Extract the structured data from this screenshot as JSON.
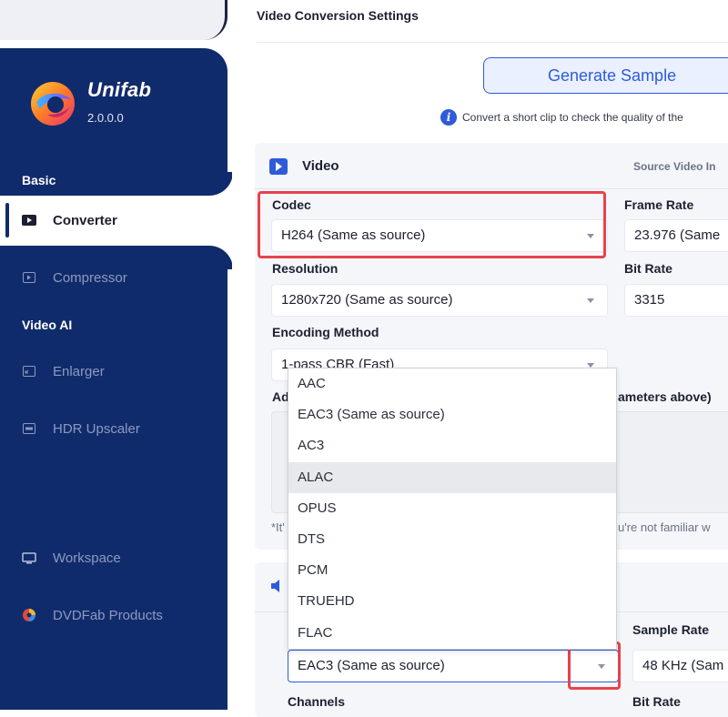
{
  "sidebar": {
    "brand": "Unifab",
    "version": "2.0.0.0",
    "sections": {
      "basic": "Basic",
      "video_ai": "Video AI"
    },
    "items": {
      "converter": "Converter",
      "compressor": "Compressor",
      "enlarger": "Enlarger",
      "hdr_upscaler": "HDR Upscaler",
      "workspace": "Workspace",
      "dvdfab_products": "DVDFab Products"
    },
    "active_item": "converter"
  },
  "main": {
    "title": "Video Conversion Settings",
    "generate_sample_label": "Generate Sample",
    "info_text": "Convert a short clip to check the quality of the"
  },
  "video": {
    "section_label": "Video",
    "source_info": "Source Video In",
    "codec": {
      "label": "Codec",
      "value": "H264 (Same as source)"
    },
    "frame_rate": {
      "label": "Frame Rate",
      "value": "23.976 (Same"
    },
    "resolution": {
      "label": "Resolution",
      "value": "1280x720 (Same as source)"
    },
    "bit_rate": {
      "label": "Bit Rate",
      "value": "3315"
    },
    "encoding_method": {
      "label": "Encoding Method",
      "value": "1-pass CBR (Fast)"
    },
    "advanced_label_start": "Ad",
    "advanced_label_end": "ameters above)",
    "footnote_start": "*It'",
    "footnote_end": "u're not familiar w"
  },
  "audio": {
    "codec_value": "EAC3 (Same as source)",
    "sample_rate": {
      "label": "Sample Rate",
      "value": "48 KHz (Sam"
    },
    "channels_label": "Channels",
    "bit_rate_label": "Bit Rate"
  },
  "audio_codec_dropdown": {
    "options": [
      "AAC",
      "EAC3 (Same as source)",
      "AC3",
      "ALAC",
      "OPUS",
      "DTS",
      "PCM",
      "TRUEHD",
      "FLAC"
    ],
    "hovered": "ALAC"
  },
  "colors": {
    "sidebar_bg": "#102b6b",
    "accent": "#2f5bd8",
    "highlight": "#e8434b"
  }
}
